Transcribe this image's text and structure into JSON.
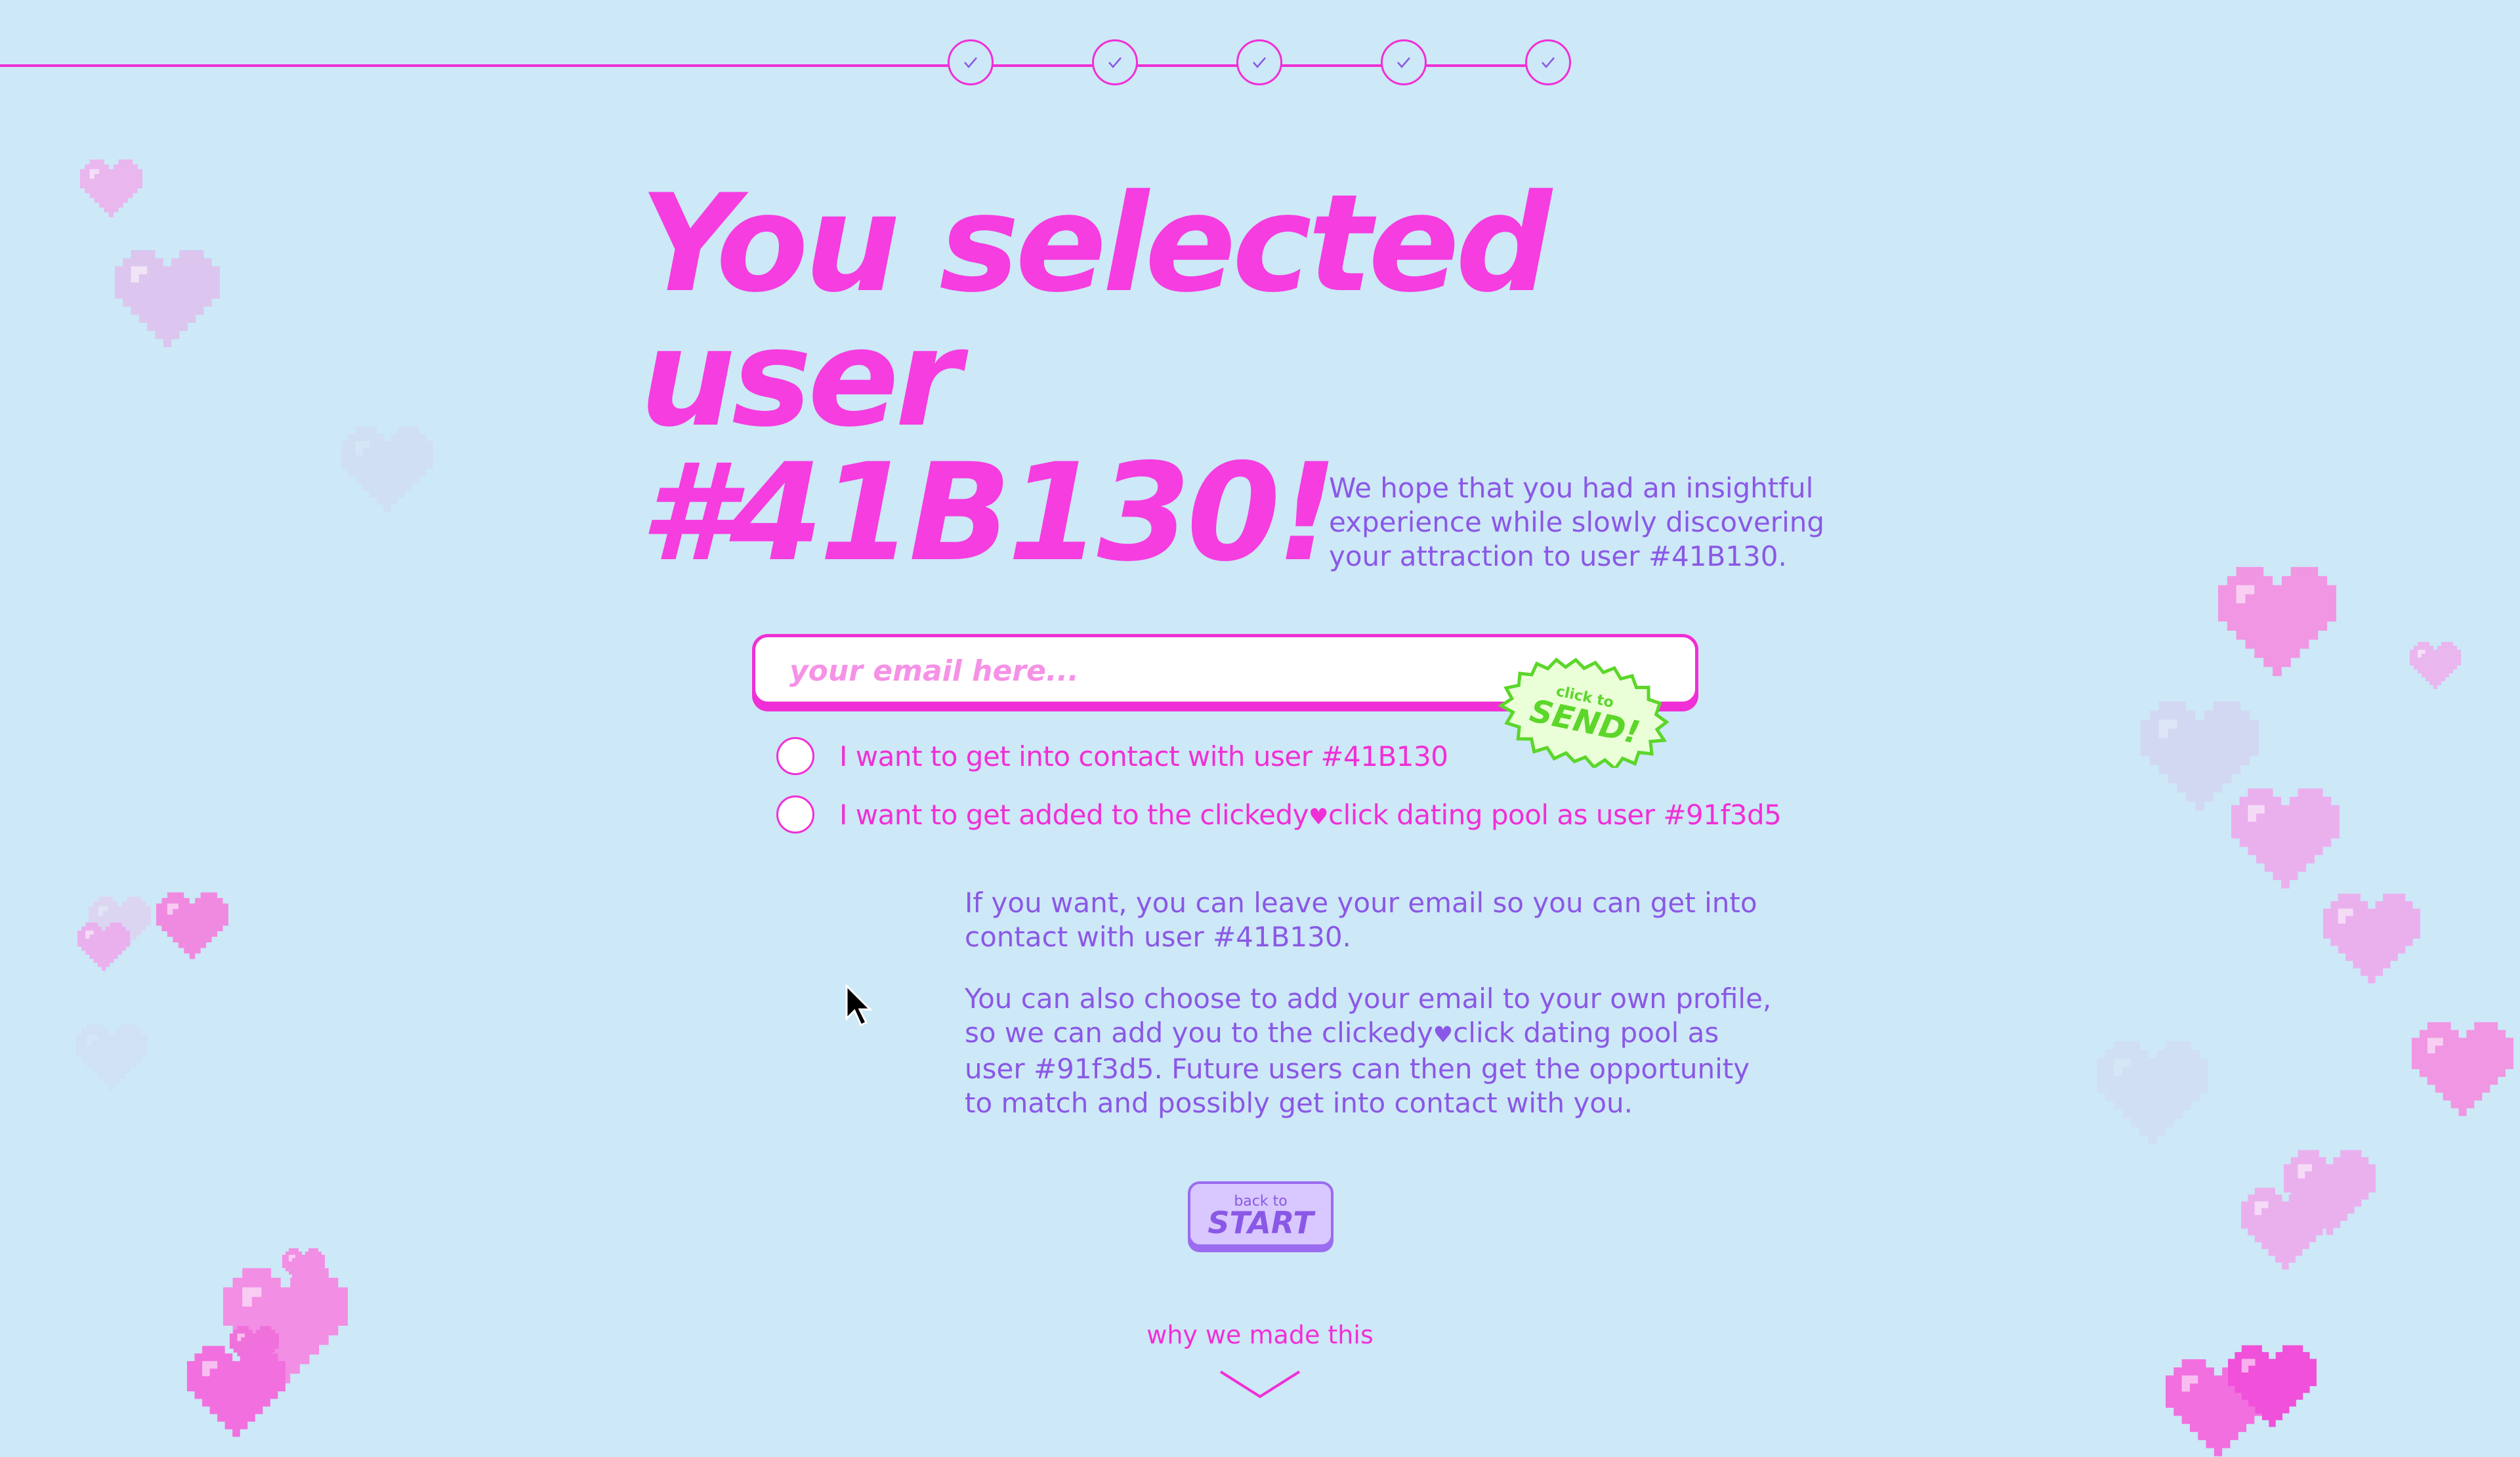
{
  "progress": {
    "steps": [
      "check-icon",
      "check-icon",
      "check-icon",
      "check-icon",
      "check-icon"
    ]
  },
  "heading": {
    "line1": "You selected user",
    "line2": "#41B130!"
  },
  "intro": "We hope that you had an insightful experience while slowly discovering your attraction to user #41B130.",
  "email": {
    "placeholder": "your email here...",
    "value": ""
  },
  "send": {
    "small": "click to",
    "big": "SEND!"
  },
  "options": [
    {
      "pre": "I want to get into contact with user #41B130",
      "post": ""
    },
    {
      "pre": "I want to get added to the clickedy",
      "post": "click dating pool as user #91f3d5"
    }
  ],
  "info": {
    "p1": "If you want, you can leave your email so you can get into contact with user #41B130.",
    "p2_pre": "You can also choose to add your email to your own profile, so we can add you to the clickedy",
    "p2_post": "click dating pool as user #91f3d5. Future users can then get the opportunity to match and possibly get into contact with you."
  },
  "back": {
    "small": "back to",
    "big": "START"
  },
  "why": "why we made this",
  "colors": {
    "background": "#cde8f7",
    "pink": "#f02fd6",
    "purple": "#8a58e6",
    "green": "#5cd62a"
  }
}
